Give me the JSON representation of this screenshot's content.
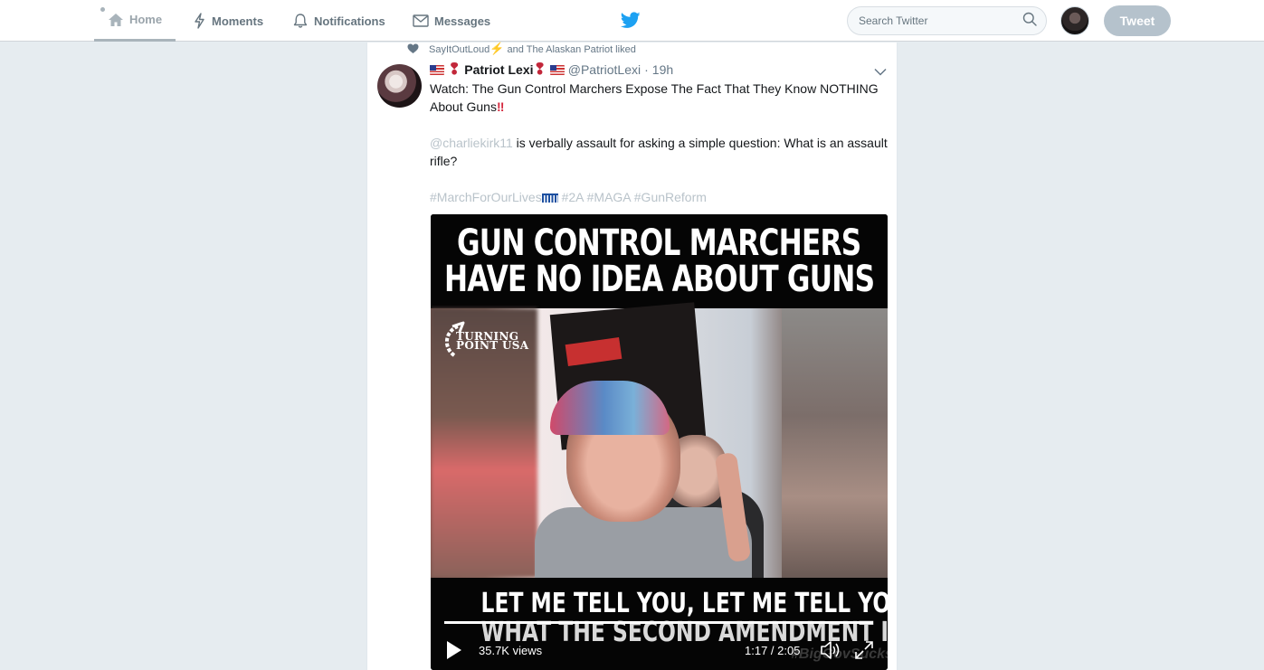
{
  "nav": {
    "home": "Home",
    "moments": "Moments",
    "notifications": "Notifications",
    "messages": "Messages"
  },
  "search": {
    "placeholder": "Search Twitter"
  },
  "tweet_button": "Tweet",
  "colors": {
    "brand": "#1da1f2",
    "tweet_button": "#b5c2cc",
    "link_muted": "#b9c3ca"
  },
  "tweet": {
    "context_user": "SayItOutLoud",
    "context_rest": "and The Alaskan Patriot liked",
    "fullname": "Patriot Lexi",
    "handle": "@PatriotLexi",
    "separator": "·",
    "time": "19h",
    "text_1": "Watch: The Gun Control Marchers Expose The Fact That They Know NOTHING About Guns",
    "mention": "@charliekirk11",
    "text_2": " is verbally assault for asking a simple question: What is an assault rifle?",
    "hashtags": [
      "#MarchForOurLives",
      "#2A",
      "#MAGA",
      "#GunReform"
    ]
  },
  "video": {
    "title_line_1": "GUN CONTROL MARCHERS",
    "title_line_2": "HAVE NO IDEA ABOUT GUNS",
    "logo_line_1": "TURNING",
    "logo_line_2": "POINT USA",
    "caption_line_1": "LET ME TELL YOU, LET ME TELL YOU",
    "caption_line_2": "WHAT THE SECOND AMENDMENT IS",
    "watermark": "#BigGovSucks",
    "views": "35.7K views",
    "duration": "1:17 / 2:05",
    "progress": 1.0
  },
  "icons": [
    "home-icon",
    "lightning-icon",
    "bell-icon",
    "envelope-icon",
    "twitter-bird-icon",
    "search-icon",
    "heart-icon",
    "chevron-down-icon",
    "play-icon",
    "volume-icon",
    "expand-icon"
  ]
}
